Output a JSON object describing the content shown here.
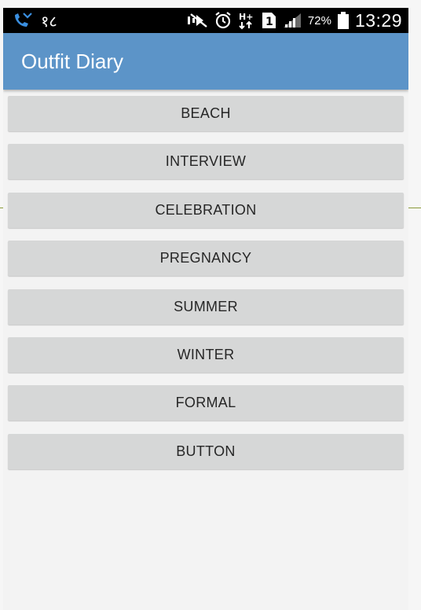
{
  "status_bar": {
    "left_text": "१८",
    "battery_percent": "72%",
    "clock": "13:29",
    "icons": [
      "missed-call-icon",
      "mute-icon",
      "alarm-icon",
      "hplus-data-icon",
      "sim-1-icon",
      "signal-icon",
      "battery-icon"
    ]
  },
  "app_bar": {
    "title": "Outfit Diary",
    "color": "#5c94c8"
  },
  "buttons": [
    {
      "label": "BEACH"
    },
    {
      "label": "INTERVIEW"
    },
    {
      "label": "CELEBRATION"
    },
    {
      "label": "PREGNANCY"
    },
    {
      "label": "SUMMER"
    },
    {
      "label": "WINTER"
    },
    {
      "label": "FORMAL"
    },
    {
      "label": "BUTTON"
    }
  ]
}
